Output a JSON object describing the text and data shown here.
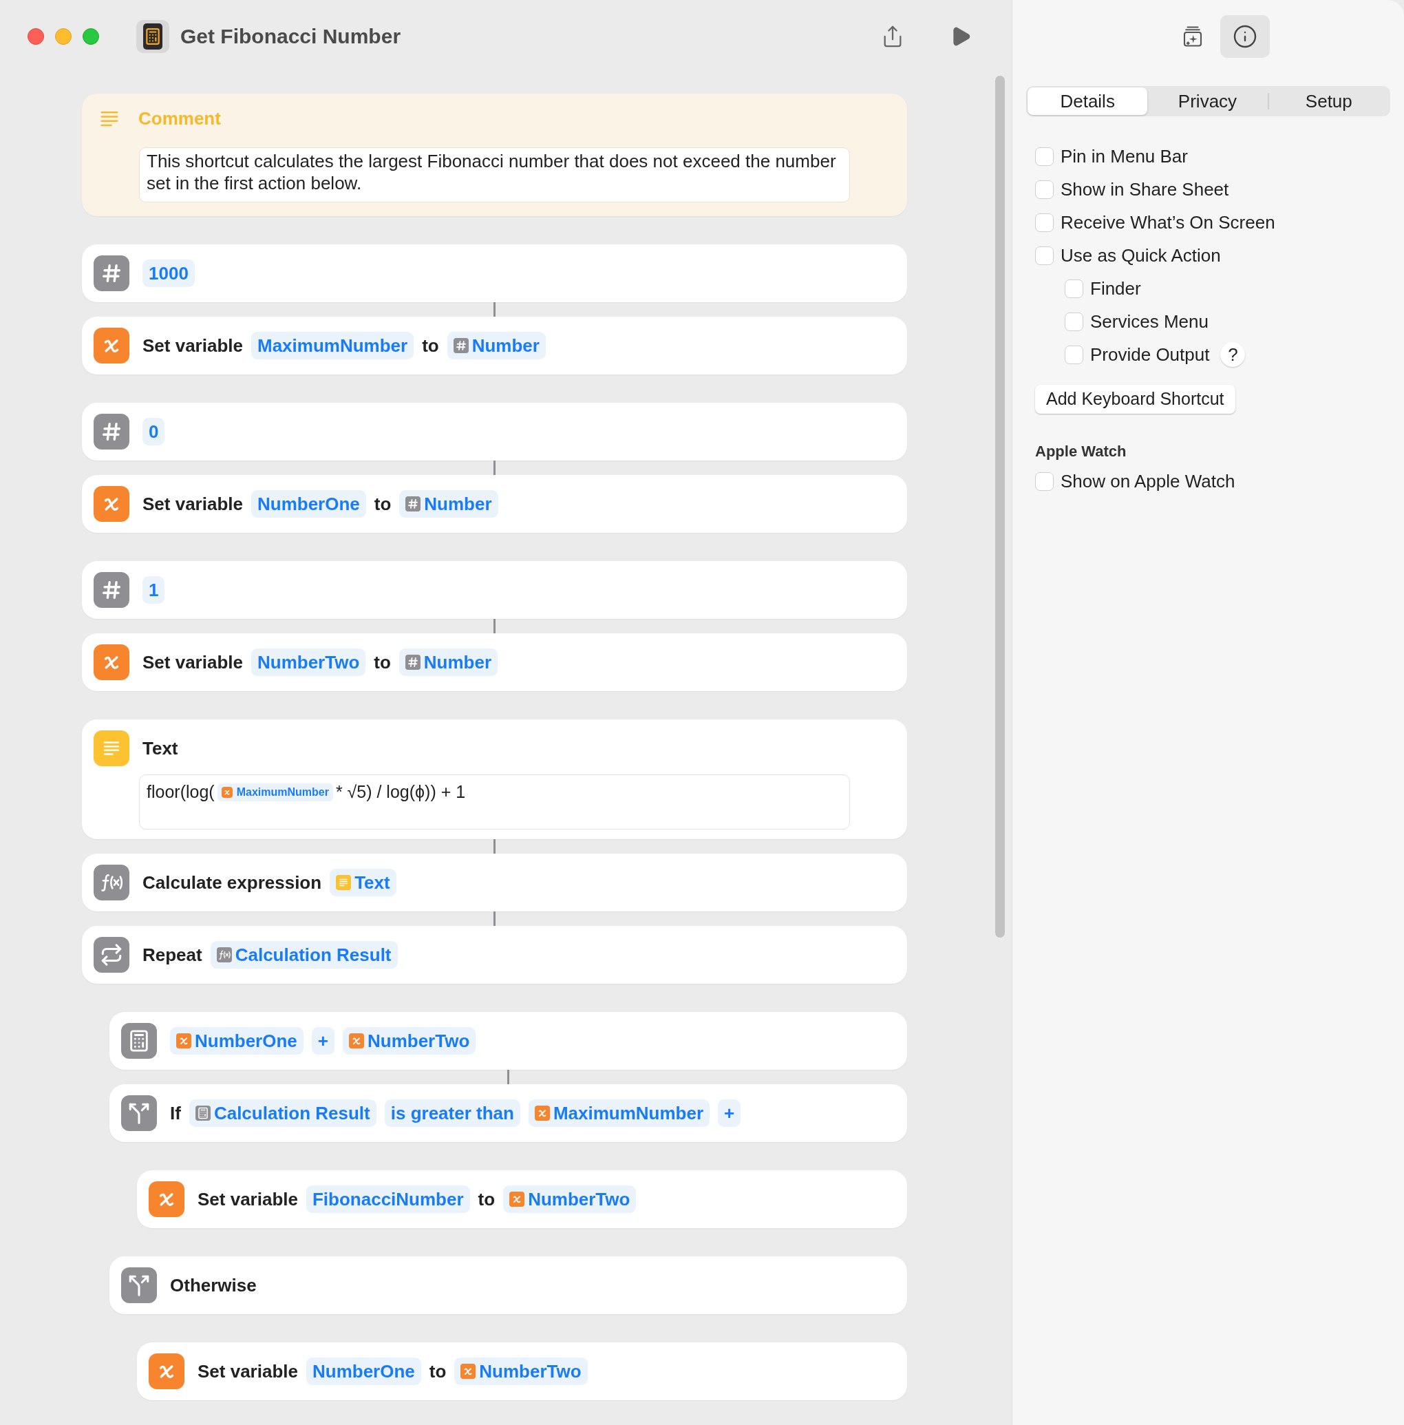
{
  "window": {
    "title": "Get Fibonacci Number"
  },
  "comment": {
    "title": "Comment",
    "text": "This shortcut calculates the largest Fibonacci number that does not exceed the number set in the first action below."
  },
  "actions": [
    {
      "kind": "number",
      "connected": false,
      "parts": [
        {
          "kind": "token",
          "text": "1000"
        }
      ]
    },
    {
      "kind": "set_variable",
      "connected": true,
      "title": "Set variable",
      "parts": [
        {
          "kind": "token",
          "text": "MaximumNumber"
        },
        {
          "kind": "word",
          "text": "to"
        },
        {
          "kind": "number_token",
          "text": "Number"
        }
      ]
    },
    {
      "kind": "number",
      "connected": false,
      "parts": [
        {
          "kind": "token",
          "text": "0"
        }
      ]
    },
    {
      "kind": "set_variable",
      "connected": true,
      "title": "Set variable",
      "parts": [
        {
          "kind": "token",
          "text": "NumberOne"
        },
        {
          "kind": "word",
          "text": "to"
        },
        {
          "kind": "number_token",
          "text": "Number"
        }
      ]
    },
    {
      "kind": "number",
      "connected": false,
      "parts": [
        {
          "kind": "token",
          "text": "1"
        }
      ]
    },
    {
      "kind": "set_variable",
      "connected": true,
      "title": "Set variable",
      "parts": [
        {
          "kind": "token",
          "text": "NumberTwo"
        },
        {
          "kind": "word",
          "text": "to"
        },
        {
          "kind": "number_token",
          "text": "Number"
        }
      ]
    },
    {
      "kind": "text",
      "connected": false,
      "title": "Text",
      "content": [
        {
          "kind": "word",
          "text": "floor(log("
        },
        {
          "kind": "variable_token",
          "text": "MaximumNumber"
        },
        {
          "kind": "word",
          "text": "* √5) / log(ϕ)) + 1"
        }
      ]
    },
    {
      "kind": "calculate_expression",
      "connected": true,
      "title": "Calculate expression",
      "parts": [
        {
          "kind": "text_token",
          "text": "Text"
        }
      ]
    },
    {
      "kind": "repeat",
      "connected": true,
      "title": "Repeat",
      "parts": [
        {
          "kind": "function_token",
          "text": "Calculation Result"
        }
      ],
      "children": [
        {
          "kind": "calculate",
          "connected": false,
          "parts": [
            {
              "kind": "variable_token",
              "text": "NumberOne"
            },
            {
              "kind": "token",
              "text": "+"
            },
            {
              "kind": "variable_token",
              "text": "NumberTwo"
            }
          ]
        },
        {
          "kind": "if",
          "connected": true,
          "title": "If",
          "parts": [
            {
              "kind": "calculator_token",
              "text": "Calculation Result"
            },
            {
              "kind": "token",
              "text": "is greater than"
            },
            {
              "kind": "variable_token",
              "text": "MaximumNumber"
            },
            {
              "kind": "token",
              "text": "+"
            }
          ],
          "children": [
            {
              "kind": "set_variable",
              "connected": false,
              "title": "Set variable",
              "parts": [
                {
                  "kind": "token",
                  "text": "FibonacciNumber"
                },
                {
                  "kind": "word",
                  "text": "to"
                },
                {
                  "kind": "variable_token",
                  "text": "NumberTwo"
                }
              ]
            }
          ]
        },
        {
          "kind": "otherwise",
          "connected": false,
          "title": "Otherwise",
          "children": [
            {
              "kind": "set_variable",
              "connected": false,
              "title": "Set variable",
              "parts": [
                {
                  "kind": "token",
                  "text": "NumberOne"
                },
                {
                  "kind": "word",
                  "text": "to"
                },
                {
                  "kind": "variable_token",
                  "text": "NumberTwo"
                }
              ]
            }
          ]
        }
      ]
    }
  ],
  "inspector": {
    "buttons": [
      {
        "kind": "gallery",
        "selected": false
      },
      {
        "kind": "info",
        "selected": true
      }
    ],
    "tabs": [
      {
        "label": "Details",
        "selected": true
      },
      {
        "label": "Privacy",
        "selected": false
      },
      {
        "label": "Setup",
        "selected": false
      }
    ],
    "options": [
      {
        "label": "Pin in Menu Bar",
        "checked": false
      },
      {
        "label": "Show in Share Sheet",
        "checked": false
      },
      {
        "label": "Receive What’s On Screen",
        "checked": false
      },
      {
        "label": "Use as Quick Action",
        "checked": false,
        "children": [
          {
            "label": "Finder",
            "checked": false
          },
          {
            "label": "Services Menu",
            "checked": false
          },
          {
            "label": "Provide Output",
            "checked": false,
            "help": "?"
          }
        ]
      }
    ],
    "shortcut_button": "Add Keyboard Shortcut",
    "sections": [
      {
        "title": "Apple Watch",
        "options": [
          {
            "label": "Show on Apple Watch",
            "checked": false
          }
        ]
      }
    ]
  }
}
